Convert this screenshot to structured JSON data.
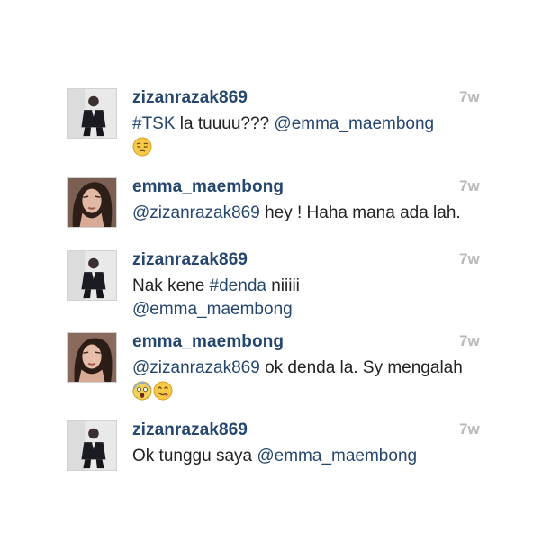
{
  "comments": [
    {
      "username": "zizanrazak869",
      "time": "7w",
      "hashtag": "#TSK",
      "text_after_hashtag": " la tuuuu??? ",
      "mention": "@emma_maembong",
      "emoji": "pensive-face-emoji"
    },
    {
      "username": "emma_maembong",
      "time": "7w",
      "mention": "@zizanrazak869",
      "text": " hey ! Haha mana ada lah."
    },
    {
      "username": "zizanrazak869",
      "time": "7w",
      "text_before_hashtag": "Nak kene ",
      "hashtag": "#denda",
      "text_after_hashtag": " niiiii ",
      "mention": "@emma_maembong"
    },
    {
      "username": "emma_maembong",
      "time": "7w",
      "mention": "@zizanrazak869",
      "text": " ok denda la. Sy mengalah ",
      "emojis": [
        "screaming-face-emoji",
        "savoring-food-face-emoji"
      ]
    },
    {
      "username": "zizanrazak869",
      "time": "7w",
      "text": "Ok tunggu saya ",
      "mention": "@emma_maembong"
    }
  ]
}
